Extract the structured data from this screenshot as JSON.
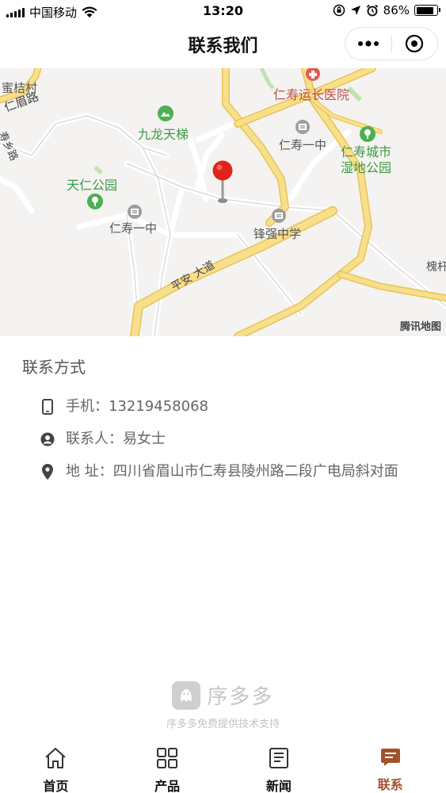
{
  "status_bar": {
    "carrier": "中国移动",
    "time": "13:20",
    "battery": "86%",
    "battery_level": 0.86
  },
  "nav": {
    "title": "联系我们"
  },
  "map": {
    "labels": {
      "mijuecun": "蜜桔村",
      "renmeilu": "仁眉路",
      "shouxiang": "寿乡路",
      "jiulong": "九龙天梯",
      "tianren": "天仁公园",
      "hospital": "仁寿运长医院",
      "school1": "仁寿一中",
      "school2": "仁寿一中",
      "wetland": "仁寿城市\n湿地公园",
      "fengqiang": "锋强中学",
      "pingan": "平安 大道",
      "huai": "槐杆",
      "watermark": "腾讯地图"
    }
  },
  "contact": {
    "title": "联系方式",
    "phone_label": "手机：",
    "phone": "13219458068",
    "person_label": "联系人：",
    "person": "易女士",
    "address_label": "地 址：",
    "address": "四川省眉山市仁寿县陵州路二段广电局斜对面"
  },
  "brand": {
    "name": "序多多",
    "sub": "序多多免费提供技术支持"
  },
  "tabs": [
    {
      "label": "首页",
      "icon": "home-icon"
    },
    {
      "label": "产品",
      "icon": "grid-icon"
    },
    {
      "label": "新闻",
      "icon": "news-icon"
    },
    {
      "label": "联系",
      "icon": "message-icon"
    }
  ],
  "colors": {
    "accent": "#a0522d",
    "map_road": "#f5d77a",
    "map_green": "#3c9a45",
    "marker": "#e2231a"
  }
}
